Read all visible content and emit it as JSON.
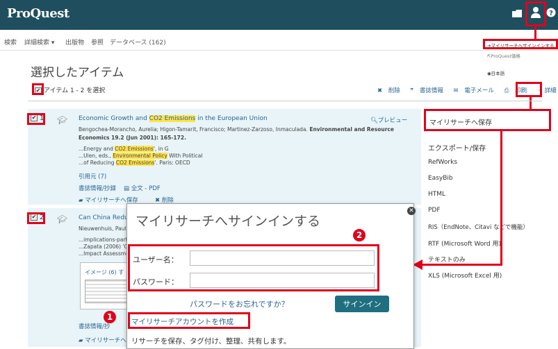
{
  "header": {
    "logo": "ProQuest",
    "folder_icon": "folder-icon",
    "user_icon": "user-icon",
    "help_icon": "help-icon"
  },
  "nav": {
    "items": [
      "検索",
      "詳細検索 ▾",
      "出版物",
      "参照",
      "データベース (162)"
    ]
  },
  "user_menu": {
    "signin": "マイリサーチへサインインする",
    "proquest_item": "ProQuest価格",
    "language": "日本語"
  },
  "page": {
    "title": "選択したアイテム",
    "select_label": "アイテム 1 - 2 を選択"
  },
  "toolbar": {
    "delete": "削除",
    "cite": "書誌情報",
    "email": "電子メール",
    "print": "印刷",
    "more": "詳細"
  },
  "results": [
    {
      "num": "1",
      "title_pre": "Economic Growth and ",
      "title_hl": "CO2 Emissions",
      "title_post": " in the European Union",
      "authors": "Bengochea-Morancho, Aurelia; Higon-Tamarit, Francisco; Martinez-Zarzoso, Inmaculada.",
      "authors_bold": "Environmental and Resource",
      "journal": "Economics 19.2 (Jun 2001): 165-172.",
      "snip1_pre": "...Energy and ",
      "snip1_hl": "CO2 Emissions",
      "snip1_post": "', in G",
      "snip2_pre": "...Ulen, eds., ",
      "snip2_hl": "Environmental Policy",
      "snip2_post": " With Political",
      "snip3_pre": "...of Reducing ",
      "snip3_hl": "CO2 Emissions",
      "snip3_post": "'. Paris: OECD",
      "cited_by": "引用元 (7)",
      "abstract_link": "書誌情報/抄録",
      "fulltext_link": "全文 - PDF",
      "save_link": "マイリサーチへ保存",
      "delete_link": "削除",
      "preview": "プレビュー"
    },
    {
      "num": "2",
      "title": "Can China Reduc",
      "authors": "Nieuwenhuis, Paul; Z",
      "snip1": "...implications-part",
      "snip2": "...Zapata (2006) 'C",
      "snip3": "...Impact Assessme",
      "image_label": "イメージ (6) す",
      "abstract_link": "書誌情報/抄",
      "save_link": "マイリサーチへ"
    }
  ],
  "sidebar": {
    "save": "マイリサーチへ保存",
    "export_heading": "エクスポート/保存",
    "items": [
      "RefWorks",
      "EasyBib",
      "HTML",
      "PDF",
      "RIS（EndNote、Citavi などで機能）",
      "RTF (Microsoft Word 用)",
      "テキストのみ",
      "XLS (Microsoft Excel 用)"
    ]
  },
  "dialog": {
    "title": "マイリサーチへサインインする",
    "username_label": "ユーザー名：",
    "password_label": "パスワード：",
    "forgot": "パスワードをお忘れですか？",
    "signin_button": "サインイン",
    "create_account": "マイリサーチアカウントを作成",
    "subtext": "リサーチを保存、タグ付け、整理、共有します。"
  },
  "badges": {
    "one": "1",
    "two": "2"
  },
  "colors": {
    "header": "#1f4e5f",
    "accent_red": "#e1001a",
    "link": "#2a6496",
    "highlight": "#ffe34d",
    "button": "#1f6f80"
  }
}
